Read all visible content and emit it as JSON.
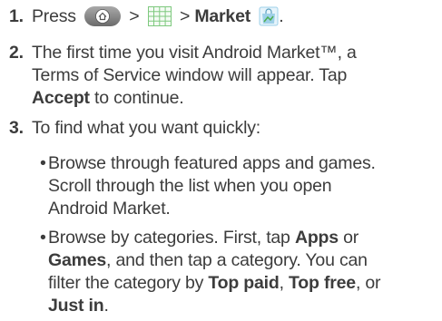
{
  "steps": [
    {
      "number": "1.",
      "press": "Press",
      "sep1": ">",
      "sep2": ">",
      "market": "Market",
      "end": "."
    },
    {
      "number": "2.",
      "text1": "The first time you visit Android Market™, a",
      "text2": "Terms of Service window will appear. Tap",
      "accept": "Accept",
      "text3": "to continue."
    },
    {
      "number": "3.",
      "text": "To find what you want quickly:"
    }
  ],
  "bullets": [
    {
      "dot": "•",
      "line1": "Browse through featured apps and games.",
      "line2": "Scroll through the list when you open",
      "line3": "Android Market."
    },
    {
      "dot": "•",
      "line1a": "Browse by categories. First, tap",
      "apps": "Apps",
      "line1b": "or",
      "games": "Games",
      "line2b": ", and then tap a category. You can",
      "line3a": "filter the category by",
      "top_paid": "Top paid",
      "comma1": ",",
      "top_free": "Top free",
      "line3c": ", or",
      "just_in": "Just in",
      "end": "."
    }
  ],
  "icons": {
    "home": "home-icon",
    "all_apps": "all-apps-icon",
    "market": "market-icon"
  },
  "colors": {
    "text": "#3c3c3c",
    "home_button": "#8a8a8a",
    "grid": "#7fc97f",
    "market_bag": "#9ed0e8"
  }
}
